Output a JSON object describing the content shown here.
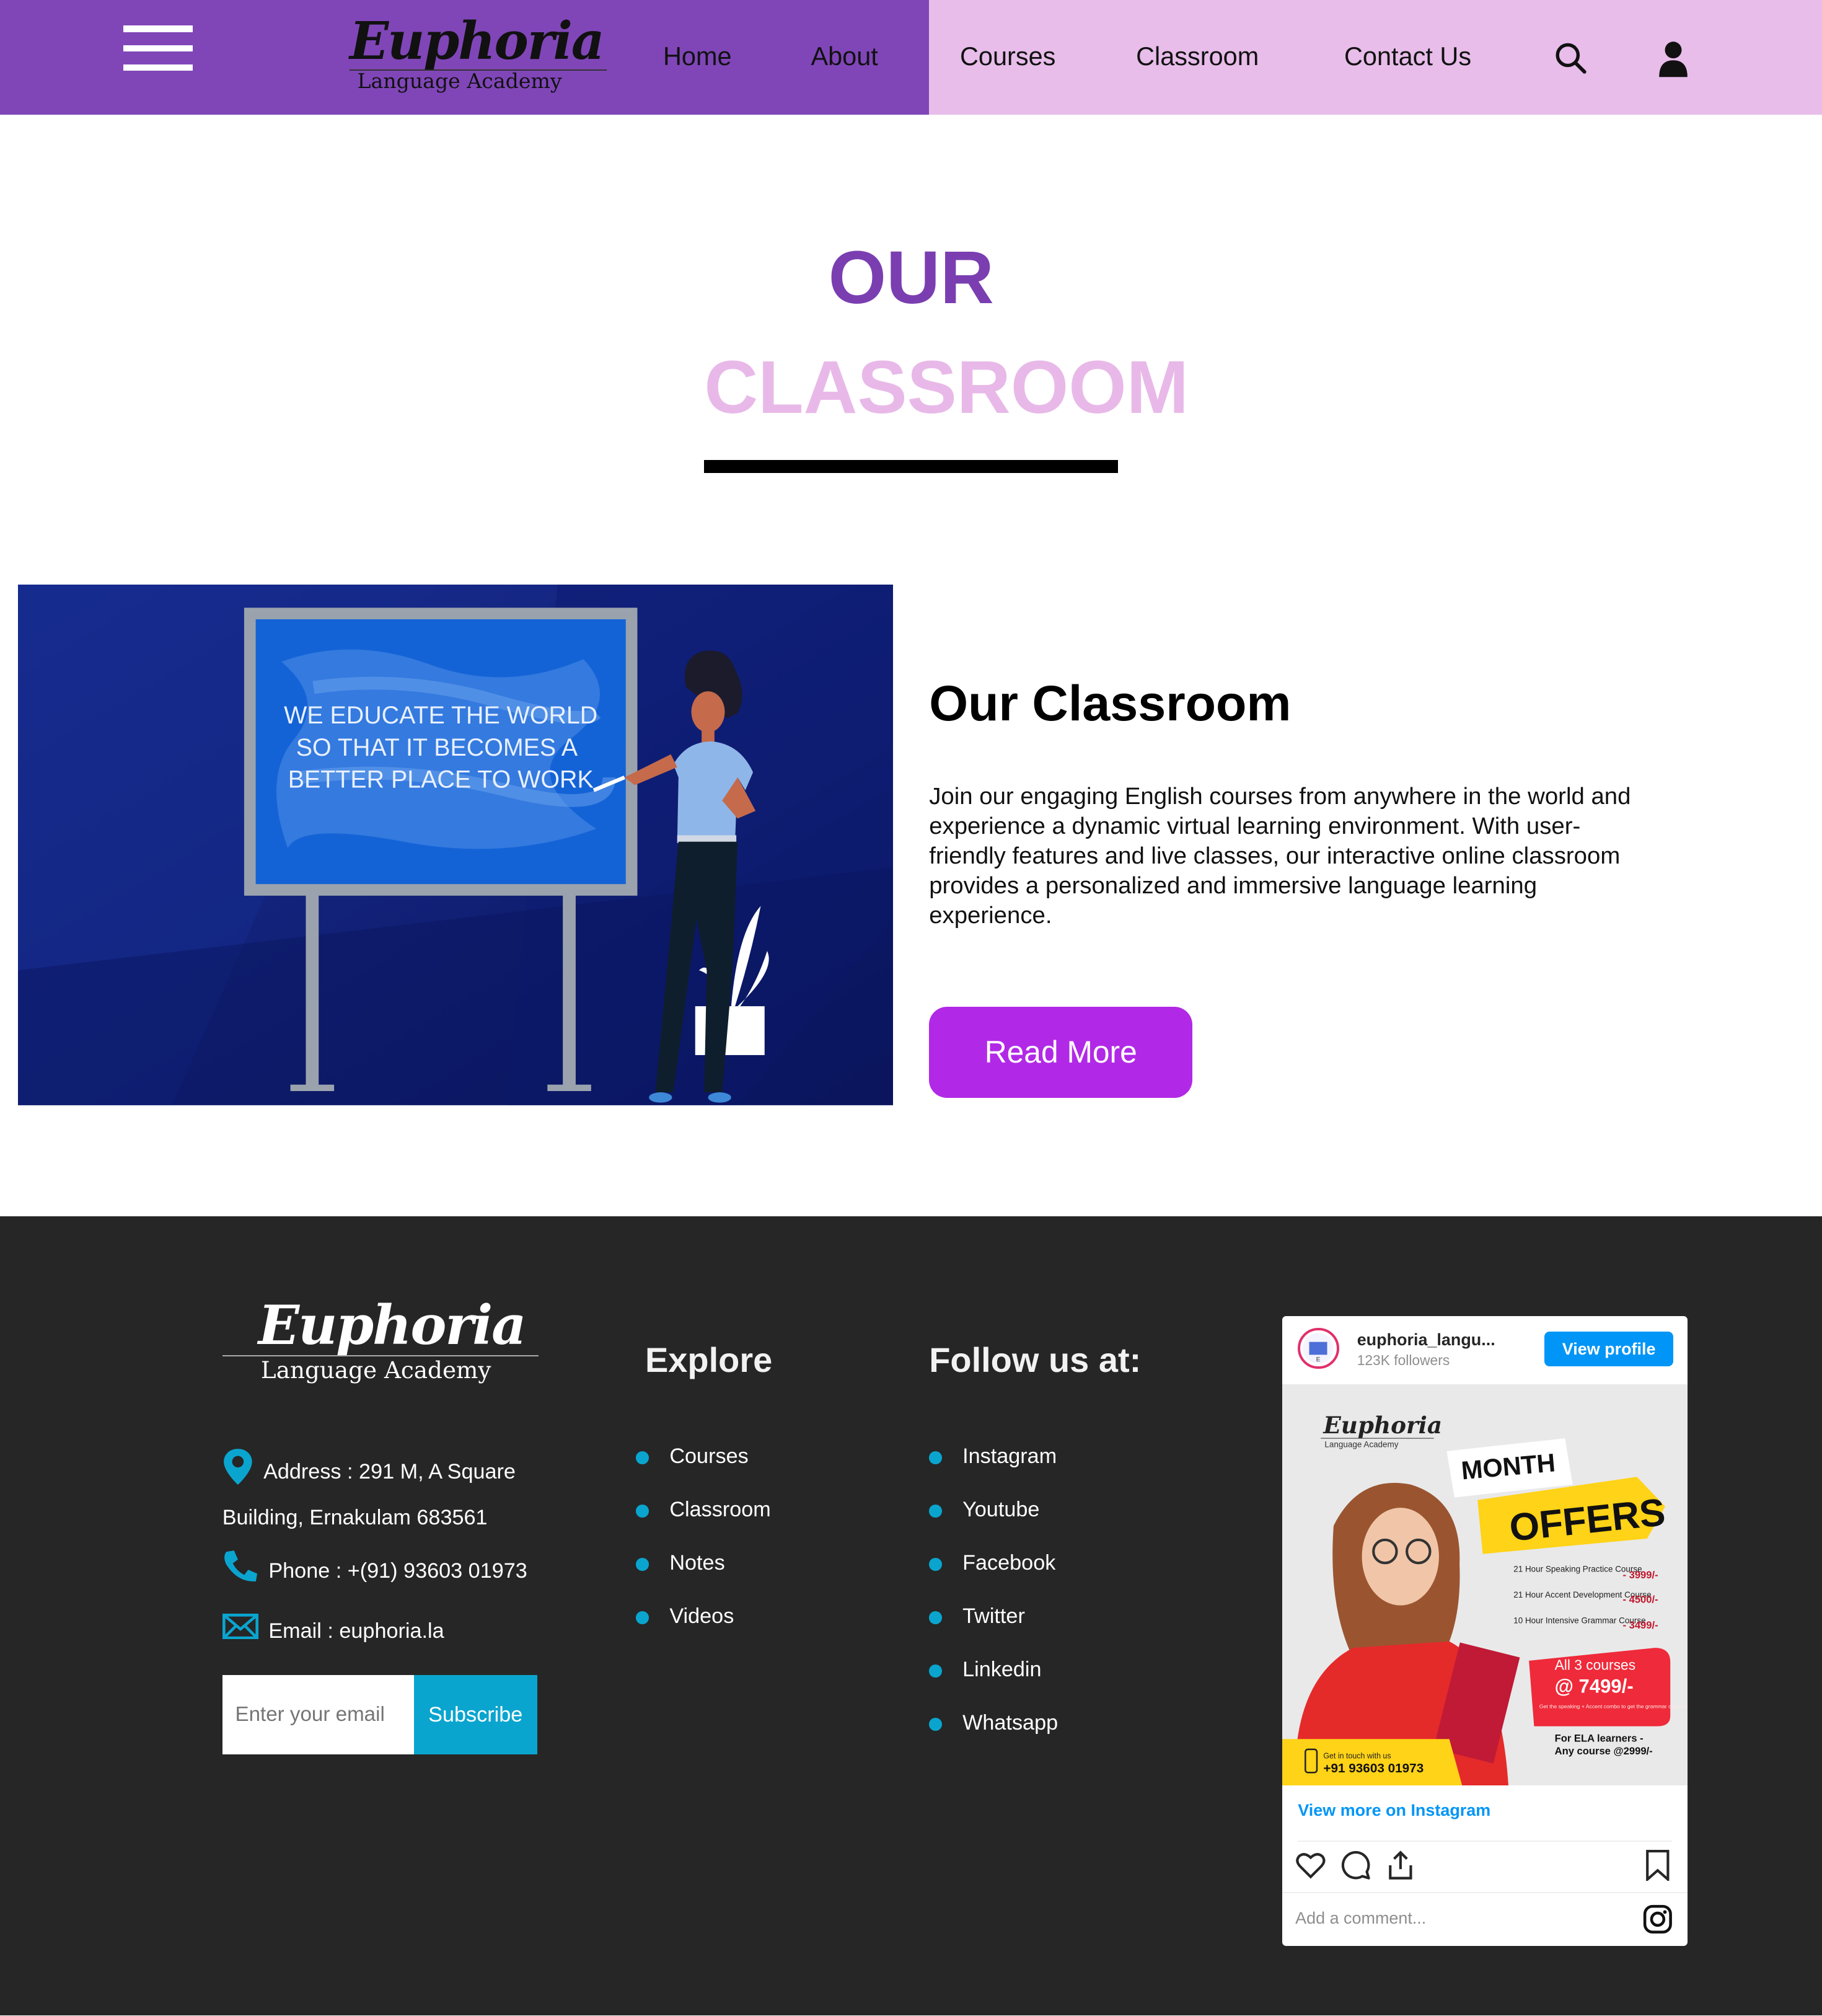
{
  "brand": {
    "name": "Euphoria",
    "tagline": "Language Academy"
  },
  "colors": {
    "header_left": "#8046b8",
    "header_right": "#e8bdea",
    "title_our": "#7a3eb1",
    "title_classroom": "#e8b9e8",
    "read_more": "#b129e6",
    "footer_bg": "#262626",
    "accent": "#0aa5cf",
    "instagram_blue": "#0095f6"
  },
  "nav": {
    "items": [
      "Home",
      "About",
      "Courses",
      "Classroom",
      "Contact Us"
    ],
    "icons": [
      "menu-icon",
      "search-icon",
      "user-icon"
    ]
  },
  "hero": {
    "title_line1": "OUR",
    "title_line2": "CLASSROOM",
    "board_lines": [
      "WE EDUCATE THE WORLD",
      "SO THAT IT BECOMES A",
      "BETTER PLACE TO WORK"
    ],
    "heading": "Our Classroom",
    "body": "Join our engaging English courses from anywhere in the world and experience a dynamic virtual learning environment. With user-friendly features and live classes, our interactive online classroom provides a personalized and immersive language learning experience.",
    "cta": "Read More"
  },
  "footer": {
    "contact": {
      "address_line1": "Address : 291 M, A Square",
      "address_line2": "Building, Ernakulam 683561",
      "phone": "Phone : +(91) 93603 01973",
      "email": "Email : euphoria.la"
    },
    "subscribe": {
      "placeholder": "Enter your email",
      "button": "Subscribe"
    },
    "explore": {
      "heading": "Explore",
      "items": [
        "Courses",
        "Classroom",
        "Notes",
        "Videos"
      ]
    },
    "follow": {
      "heading": "Follow us at:",
      "items": [
        "Instagram",
        "Youtube",
        "Facebook",
        "Twitter",
        "Linkedin",
        "Whatsapp"
      ]
    }
  },
  "instagram": {
    "username": "euphoria_langu...",
    "followers": "123K followers",
    "view_profile": "View profile",
    "view_more": "View more on Instagram",
    "comment_placeholder": "Add a comment...",
    "post": {
      "brand": "Euphoria",
      "brand_sub": "Language Academy",
      "month": "MONTH",
      "offers": "OFFERS",
      "courses": [
        {
          "name": "21 Hour Speaking Practice Course",
          "price": "- 3999/-"
        },
        {
          "name": "21 Hour Accent Development Course",
          "price": "- 4500/-"
        },
        {
          "name": "10 Hour Intensive Grammar Course",
          "price": "- 3499/-"
        }
      ],
      "bundle_title": "All 3 courses",
      "bundle_price": "@ 7499/-",
      "bundle_note": "Get the speaking + Accent combo to get the grammar course for free",
      "ela_note_line1": "For ELA learners -",
      "ela_note_line2": "Any course @2999/-",
      "contact_label": "Get in touch with us",
      "contact_phone": "+91 93603 01973"
    }
  }
}
